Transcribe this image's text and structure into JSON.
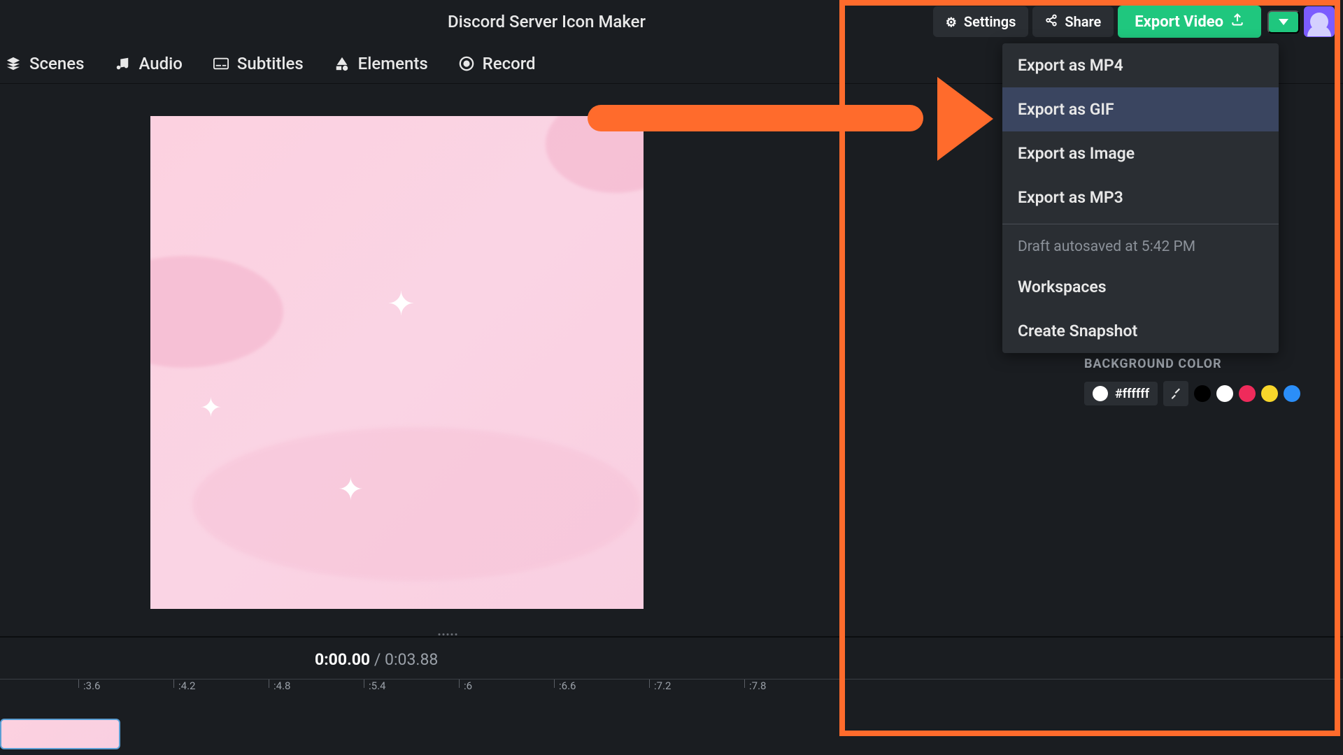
{
  "header": {
    "title": "Discord Server Icon Maker",
    "settings": "Settings",
    "share": "Share",
    "export": "Export Video"
  },
  "toolbar": {
    "scenes": "Scenes",
    "audio": "Audio",
    "subtitles": "Subtitles",
    "elements": "Elements",
    "record": "Record"
  },
  "export_menu": {
    "mp4": "Export as MP4",
    "gif": "Export as GIF",
    "image": "Export as Image",
    "mp3": "Export as MP3",
    "autosave": "Draft autosaved at 5:42 PM",
    "workspaces": "Workspaces",
    "snapshot": "Create Snapshot"
  },
  "panel": {
    "bg_label": "BACKGROUND COLOR",
    "bg_hex": "#ffffff",
    "swatches": [
      "#000000",
      "#ffffff",
      "#ef2b5b",
      "#f8d62b",
      "#2b8ef8"
    ]
  },
  "timeline": {
    "current": "0:00.00",
    "sep": " / ",
    "total": "0:03.88",
    "ticks": [
      ":3.6",
      ":4.2",
      ":4.8",
      ":5.4",
      ":6",
      ":6.6",
      ":7.2",
      ":7.8"
    ]
  }
}
